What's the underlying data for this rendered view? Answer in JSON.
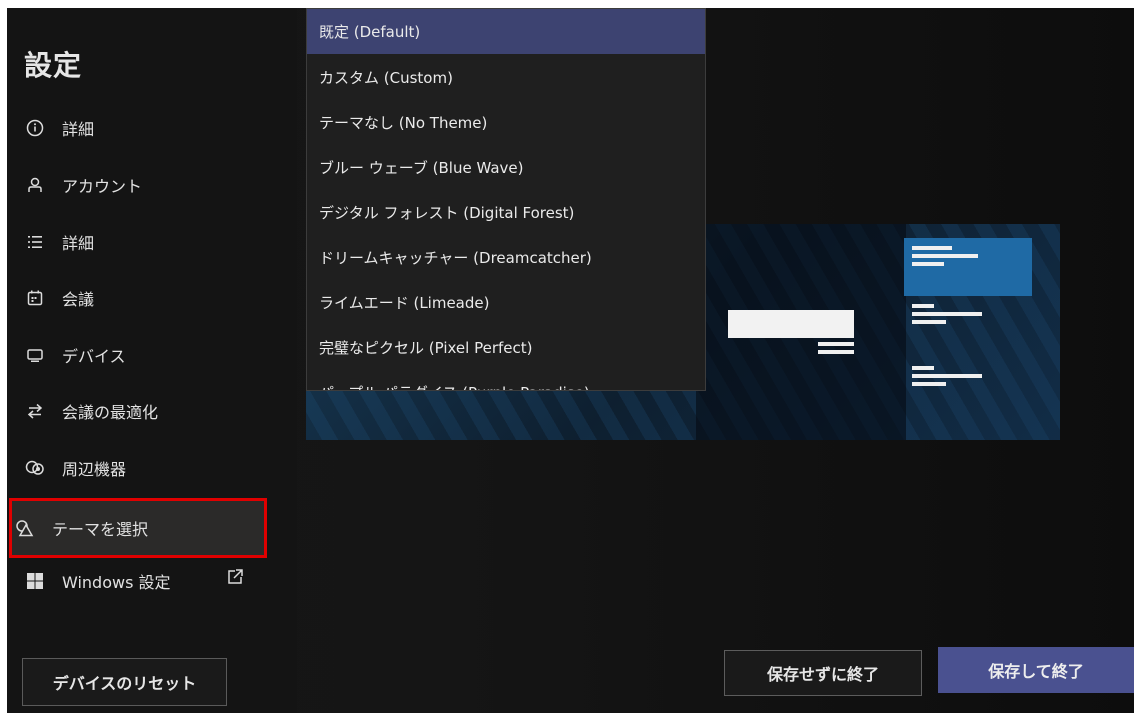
{
  "sidebar": {
    "title": "設定",
    "items": [
      {
        "label": "詳細",
        "icon": "info-icon"
      },
      {
        "label": "アカウント",
        "icon": "person-icon"
      },
      {
        "label": "詳細",
        "icon": "list-icon"
      },
      {
        "label": "会議",
        "icon": "calendar-icon"
      },
      {
        "label": "デバイス",
        "icon": "monitor-icon"
      },
      {
        "label": "会議の最適化",
        "icon": "arrows-swap-icon"
      },
      {
        "label": "周辺機器",
        "icon": "peripherals-icon"
      },
      {
        "label": "テーマを選択",
        "icon": "shapes-icon",
        "selected": true
      },
      {
        "label": "Windows 設定",
        "icon": "windows-logo-icon"
      }
    ],
    "reset_label": "デバイスのリセット"
  },
  "theme_dropdown": {
    "options": [
      "既定 (Default)",
      "カスタム (Custom)",
      "テーマなし (No Theme)",
      "ブルー ウェーブ (Blue Wave)",
      "デジタル フォレスト (Digital Forest)",
      "ドリームキャッチャー (Dreamcatcher)",
      "ライムエード (Limeade)",
      "完璧なピクセル (Pixel Perfect)",
      "パープル パラダイス (Purple Paradise)"
    ],
    "selected": "既定 (Default)"
  },
  "footer": {
    "cancel_label": "保存せずに終了",
    "save_label": "保存して終了"
  },
  "colors": {
    "background": "#151515",
    "accent": "#4a5190",
    "highlight_border": "#e00000",
    "selected_option": "#3d4371",
    "preview_blue": "#1f6aa5"
  }
}
